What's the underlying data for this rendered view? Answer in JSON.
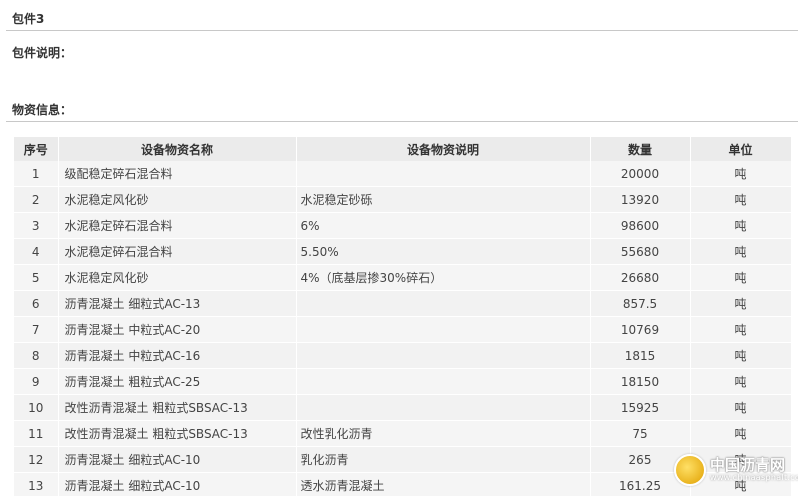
{
  "package": {
    "title": "包件3",
    "description_label": "包件说明：",
    "materials_label": "物资信息："
  },
  "table": {
    "headers": {
      "no": "序号",
      "name": "设备物资名称",
      "desc": "设备物资说明",
      "qty": "数量",
      "unit": "单位"
    },
    "rows": [
      {
        "no": "1",
        "name": "级配稳定碎石混合料",
        "desc": "",
        "qty": "20000",
        "unit": "吨"
      },
      {
        "no": "2",
        "name": "水泥稳定风化砂",
        "desc": "水泥稳定砂砾",
        "qty": "13920",
        "unit": "吨"
      },
      {
        "no": "3",
        "name": "水泥稳定碎石混合料",
        "desc": "6%",
        "qty": "98600",
        "unit": "吨"
      },
      {
        "no": "4",
        "name": "水泥稳定碎石混合料",
        "desc": "5.50%",
        "qty": "55680",
        "unit": "吨"
      },
      {
        "no": "5",
        "name": "水泥稳定风化砂",
        "desc": "4%（底基层掺30%碎石）",
        "qty": "26680",
        "unit": "吨"
      },
      {
        "no": "6",
        "name": "沥青混凝土 细粒式AC-13",
        "desc": "",
        "qty": "857.5",
        "unit": "吨"
      },
      {
        "no": "7",
        "name": "沥青混凝土 中粒式AC-20",
        "desc": "",
        "qty": "10769",
        "unit": "吨"
      },
      {
        "no": "8",
        "name": "沥青混凝土 中粒式AC-16",
        "desc": "",
        "qty": "1815",
        "unit": "吨"
      },
      {
        "no": "9",
        "name": "沥青混凝土 粗粒式AC-25",
        "desc": "",
        "qty": "18150",
        "unit": "吨"
      },
      {
        "no": "10",
        "name": "改性沥青混凝土 粗粒式SBSAC-13",
        "desc": "",
        "qty": "15925",
        "unit": "吨"
      },
      {
        "no": "11",
        "name": "改性沥青混凝土 粗粒式SBSAC-13",
        "desc": "改性乳化沥青",
        "qty": "75",
        "unit": "吨"
      },
      {
        "no": "12",
        "name": "沥青混凝土 细粒式AC-10",
        "desc": "乳化沥青",
        "qty": "265",
        "unit": "吨"
      },
      {
        "no": "13",
        "name": "沥青混凝土 细粒式AC-10",
        "desc": "透水沥青混凝土",
        "qty": "161.25",
        "unit": "吨"
      }
    ]
  },
  "watermark": {
    "name": "中国沥青网",
    "domain": "www.chinaasphalt.com"
  }
}
